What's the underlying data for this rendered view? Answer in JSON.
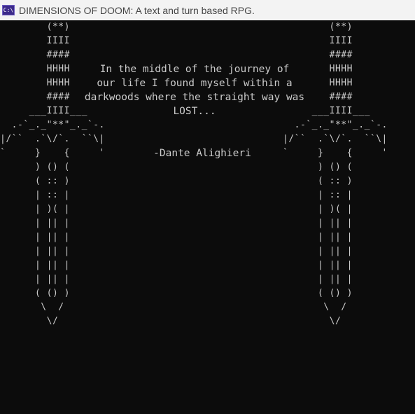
{
  "window": {
    "title": "DIMENSIONS OF DOOM: A text and turn based RPG.",
    "icon_label": "C:\\"
  },
  "console": {
    "sword_left": "        (**)\n        IIII\n        ####\n        HHHH\n        HHHH\n        ####\n     ___IIII___\n  .-`_._\"**\"_._`-.\n|/``  .`\\/`.  ``\\|\n`     }    {     '\n      ) () (\n      ( :: )\n      | :: |\n      | )( |\n      | || |\n      | || |\n      | || |\n      | || |\n      | || |\n      ( () )\n       \\  /\n        \\/",
    "sword_right": "        (**)\n        IIII\n        ####\n        HHHH\n        HHHH\n        ####\n     ___IIII___\n  .-`_._\"**\"_._`-.\n|/``  .`\\/`.  ``\\|\n`     }    {     '\n      ) () (\n      ( :: )\n      | :: |\n      | )( |\n      | || |\n      | || |\n      | || |\n      | || |\n      | || |\n      ( () )\n       \\  /\n        \\/",
    "quote_lines": "In the middle of the journey of\nour life I found myself within a\ndarkwoods where the straight way was\nLOST...",
    "author": "-Dante Alighieri"
  },
  "colors": {
    "background": "#0c0c0c",
    "text": "#cccccc",
    "titlebar": "#f3f3f3"
  }
}
